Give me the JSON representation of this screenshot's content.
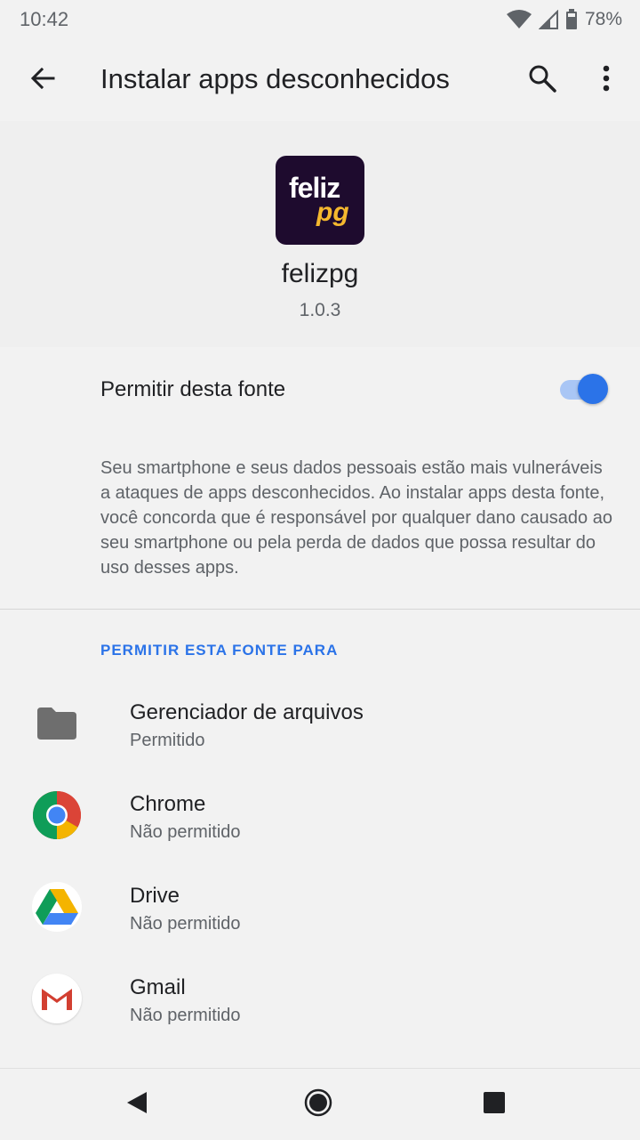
{
  "status_bar": {
    "time": "10:42",
    "battery": "78%",
    "icons": [
      "wifi-icon",
      "cell-signal-icon",
      "battery-icon"
    ]
  },
  "app_bar": {
    "title": "Instalar apps desconhecidos",
    "back_icon": "arrow-back-icon",
    "search_icon": "search-icon",
    "more_icon": "more-vert-icon"
  },
  "app": {
    "icon_text_1": "feliz",
    "icon_text_2": "pg",
    "name": "felizpg",
    "version": "1.0.3"
  },
  "allow": {
    "label": "Permitir desta fonte",
    "enabled": true
  },
  "warning": "Seu smartphone e seus dados pessoais estão mais vulneráveis a ataques de apps desconhecidos. Ao instalar apps desta fonte, você concorda que é responsável por qualquer dano causado ao seu smartphone ou pela perda de dados que possa resultar do uso desses apps.",
  "section": {
    "header": "PERMITIR ESTA FONTE PARA"
  },
  "sources": [
    {
      "name": "Gerenciador de arquivos",
      "status": "Permitido",
      "icon": "folder-icon"
    },
    {
      "name": "Chrome",
      "status": "Não permitido",
      "icon": "chrome-icon"
    },
    {
      "name": "Drive",
      "status": "Não permitido",
      "icon": "drive-icon"
    },
    {
      "name": "Gmail",
      "status": "Não permitido",
      "icon": "gmail-icon"
    }
  ],
  "colors": {
    "accent": "#2b73e8",
    "background": "#f2f2f2",
    "text_primary": "#202124",
    "text_secondary": "#5f6368"
  },
  "nav_bar": {
    "icons": [
      "nav-back-icon",
      "nav-home-icon",
      "nav-recents-icon"
    ]
  }
}
